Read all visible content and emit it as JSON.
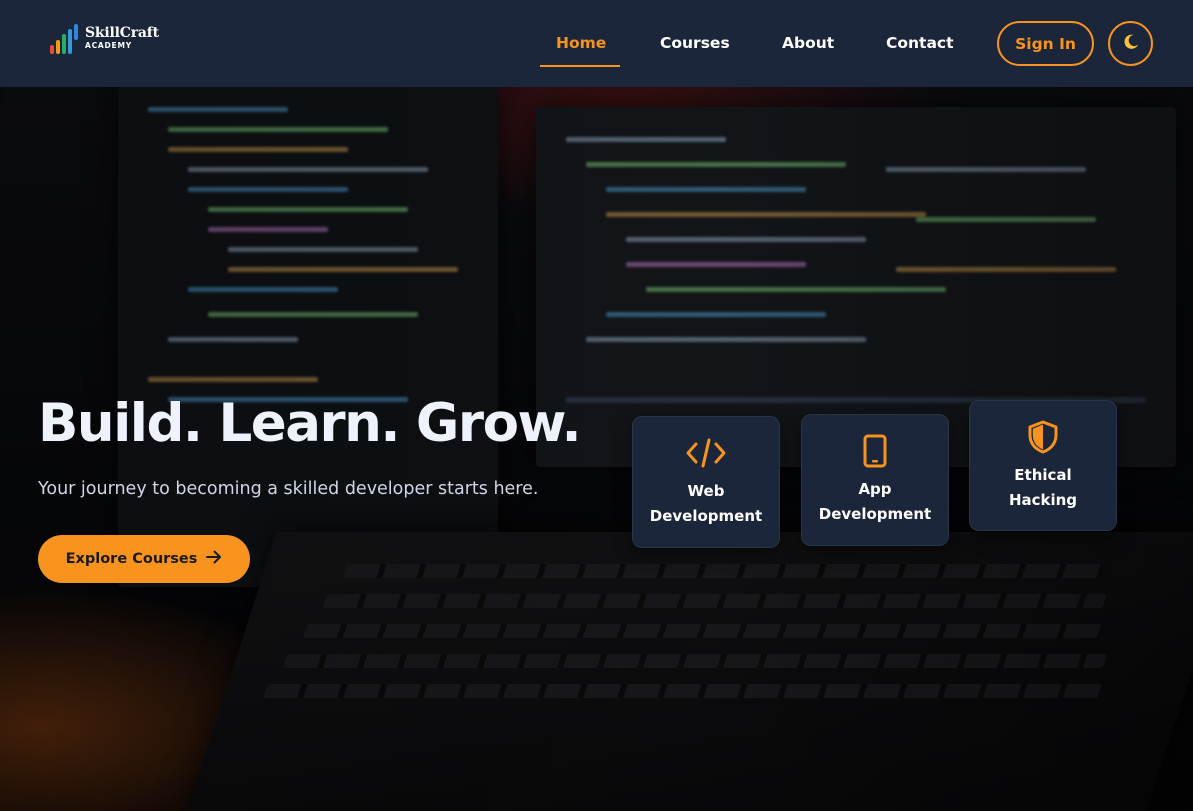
{
  "brand": {
    "name": "SkillCraft",
    "tagline": "ACADEMY",
    "logo_bar_colors": [
      "#e74c3c",
      "#f39c12",
      "#27ae60",
      "#3498db",
      "#2e86de"
    ]
  },
  "nav": {
    "items": [
      {
        "label": "Home",
        "active": true
      },
      {
        "label": "Courses",
        "active": false
      },
      {
        "label": "About",
        "active": false
      },
      {
        "label": "Contact",
        "active": false
      }
    ],
    "signin_label": "Sign In",
    "theme_toggle_icon": "moon-icon"
  },
  "hero": {
    "headline": "Build. Learn. Grow.",
    "subtitle": "Your journey to becoming a skilled developer starts here.",
    "cta_label": "Explore Courses",
    "cta_icon": "arrow-right-icon"
  },
  "categories": [
    {
      "label": "Web Development",
      "icon": "code-icon"
    },
    {
      "label": "App Development",
      "icon": "mobile-phone-icon"
    },
    {
      "label": "Ethical Hacking",
      "icon": "shield-icon"
    }
  ],
  "colors": {
    "accent": "#f7931e",
    "header_bg": "#1b263b",
    "card_bg": "#1b263b",
    "text_light": "#ffffff"
  }
}
